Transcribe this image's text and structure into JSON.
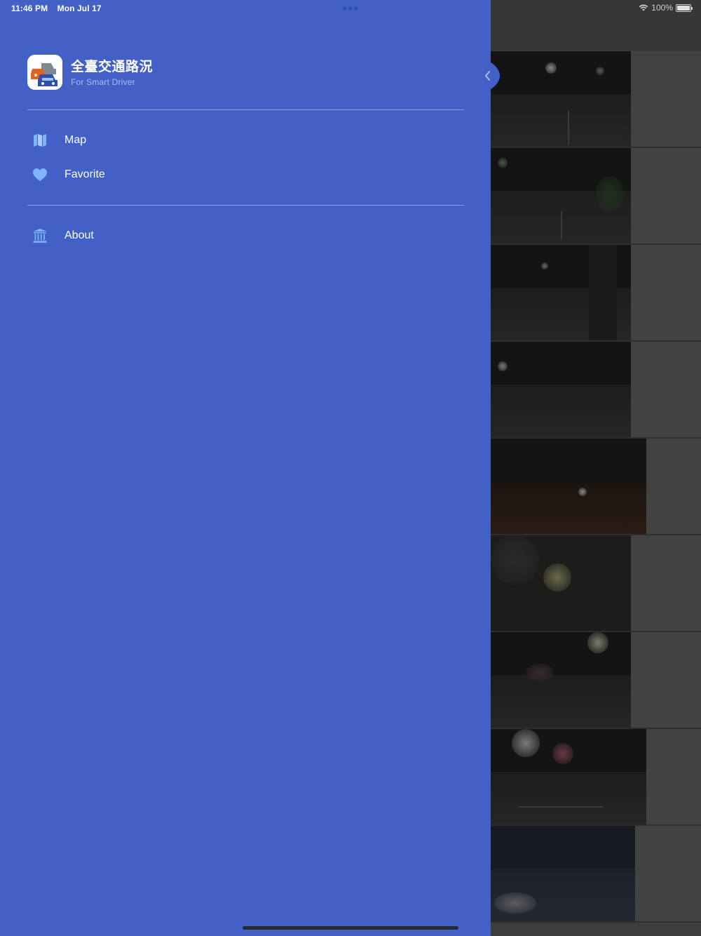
{
  "status_bar": {
    "time": "11:46 PM",
    "date": "Mon Jul 17",
    "battery": "100%",
    "wifi_icon": "wifi-icon",
    "battery_icon": "battery-icon"
  },
  "drawer": {
    "app_name": "全臺交通路況",
    "app_tagline": "For Smart Driver",
    "collapse_icon": "chevron-left-icon",
    "menu_primary": [
      {
        "label": "Map",
        "icon": "map-icon"
      },
      {
        "label": "Favorite",
        "icon": "heart-icon"
      }
    ],
    "menu_secondary": [
      {
        "label": "About",
        "icon": "bank-icon"
      }
    ]
  },
  "colors": {
    "drawer_bg": "#4360c6",
    "icon_tint": "#7fb4ff",
    "tagline": "#9fc1ff",
    "overlay_bg": "#3d3d3d"
  }
}
